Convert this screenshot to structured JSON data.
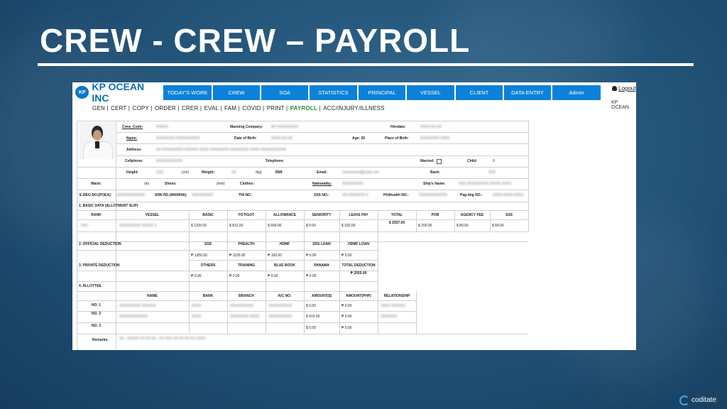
{
  "slide": {
    "title": "CREW - CREW – PAYROLL",
    "footer": "coditate"
  },
  "app": {
    "logo_badge": "KP",
    "logo_text": "KP OCEAN INC",
    "nav": [
      "TODAY'S WORK",
      "CREW",
      "SOA",
      "STATISTICS",
      "PRINCIPAL",
      "VESSEL",
      "CLIENT",
      "DATA ENTRY",
      "Admin"
    ],
    "logout": "Logout",
    "company": "KP OCEAN",
    "subnav": [
      "GEN",
      "CERT",
      "COPY",
      "ORDER",
      "CRER",
      "EVAL",
      "FAM",
      "COVID",
      "PRINT",
      "PAYROLL",
      "ACC/INJURY/ILLNESS"
    ],
    "subnav_active": "PAYROLL",
    "accent": "#0b82d8"
  },
  "profile": {
    "crew_code_label": "Crew_Code:",
    "crew_code": "XXXXX",
    "manning_label": "Manning Company:",
    "manning": "KP XXXXXXXXX",
    "hiredate_label": "Hiredate:",
    "hiredate": "XXXX-XX-XX",
    "name_label": "Name:",
    "name": "XXXXXXXX XXXXXXXXXX",
    "dob_label": "Date of Birth:",
    "dob": "XXXX-XX-XX",
    "age_label": "Age: 26",
    "pob_label": "Place of Birth:",
    "pob": "XXXXXXXX XXXX",
    "address_label": "Address:",
    "address": "XX XXXXXXXXX XXXXXX XXXX XXXXXXXX XXXXXXXX XXXX XXXXXXXXXXX",
    "cellphone_label": "Cellphone:",
    "cellphone": "XXXXXXXXXXX",
    "telephone_label": "Telephone:",
    "married_label": "Married:",
    "child_label": "Child:",
    "child": "0",
    "height_label": "Height:",
    "height": "XXX",
    "cm": "(cm)",
    "weight_label": "Weight:",
    "weight": "XX",
    "kg": "(kg)",
    "bmi_label": "BMI:",
    "email_label": "Email:",
    "email": "xxxxxxxxxx@xxxxx.xxx",
    "bank_label": "Bank:",
    "bank": "XXX",
    "waist_label": "Waist:",
    "in": "(in)",
    "shoes_label": "Shoes:",
    "mm": "(mm)",
    "clothes_label": "Clothes:",
    "nationality_label": "Nationality:",
    "nationality": "XXXXXXXXX",
    "ship_label": "Ship's Name:",
    "ship": "XXX XXXXXXXXX XXXXX XXXX",
    "ereg_label": "E-REG NO.(POEA):",
    "ereg": "XXXXXXXXXXXX",
    "srn_label": "SRN NO.(MARINA):",
    "srn": "XXXXXXXXX",
    "tin_label": "TIN NO.:",
    "sss_label": "SSS NO.:",
    "sss": "XX-XXXXXXX-X",
    "philhealth_label": "Philhealth NO.:",
    "philhealth": "XXXXXXXXXXXX",
    "pagibig_label": "Pag-ibig NO.:",
    "pagibig": "XXXX-XXXX-XXXX"
  },
  "basic": {
    "section": "1. BASIC DATA (ALLOTMENT SLIP)",
    "headers": [
      "RANK",
      "VESSEL",
      "BASIC",
      "FOT/GOT",
      "ALLOWANCE",
      "SENIORITY",
      "LEAVE PAY",
      "TOTAL",
      "POB",
      "AGENCY FEE",
      "SSS"
    ],
    "values": [
      "XXX",
      "XXXXXXXXX XXXXX X",
      "$ 1105.00",
      "$ 831.00",
      "$ 669.00",
      "$ 0.00",
      "$ 332.00",
      "$ 2937.00",
      "$ 200.00",
      "$ 80.00",
      "$ 84.00"
    ]
  },
  "official": {
    "section": "2. OFFICIAL DEDUCTION",
    "headers": [
      "SSS",
      "PHEALTH",
      "HDMF",
      "SSS LOAN",
      "HDMF LOAN"
    ],
    "values": [
      "₱ 1350.00",
      "₱ 1105.00",
      "₱ 100.00",
      "₱ 0.00",
      "₱ 0.00"
    ]
  },
  "private": {
    "section": "3. PRIVATE DEDUCTION",
    "headers": [
      "OTHERS",
      "TRAINING",
      "BLUE BOOK",
      "PANAMA",
      "TOTAL DEDUCTION"
    ],
    "values": [
      "₱ 0.00",
      "₱ 0.00",
      "₱ 0.00",
      "₱ 0.00",
      "₱ 2555.00"
    ]
  },
  "allottee": {
    "section": "4. ALLOTTEE",
    "headers": [
      "NAME",
      "BANK",
      "BRANCH",
      "A/C NO.",
      "AMOUNT($)",
      "AMOUNT(PHP)",
      "RELATIONSHIP"
    ],
    "rows": [
      {
        "no": "NO. 1",
        "name": "XXXXXXXXX XXXXXX",
        "bank": "XXXX",
        "branch": "XXXXXXXXXX",
        "acno": "XXXXXXXXXX",
        "usd": "$ 0.00",
        "php": "₱ 0.00",
        "rel": "XXXX XXXXXX"
      },
      {
        "no": "NO. 2",
        "name": "XXXXXXXXXXXX",
        "bank": "XXXX",
        "branch": "XXXXXXXX XXXX",
        "acno": "XXXXXXXXXX",
        "usd": "$ 415.00",
        "php": "₱ 0.00",
        "rel": "XXXXXXX"
      },
      {
        "no": "NO. 3",
        "name": "",
        "bank": "",
        "branch": "",
        "acno": "",
        "usd": "$ 0.00",
        "php": "₱ 0.00",
        "rel": ""
      }
    ],
    "remarks_label": "Remarks:",
    "remarks": "XX - XXXXX XX XX XX - XX XXX XX XX XX XX XXXX"
  }
}
